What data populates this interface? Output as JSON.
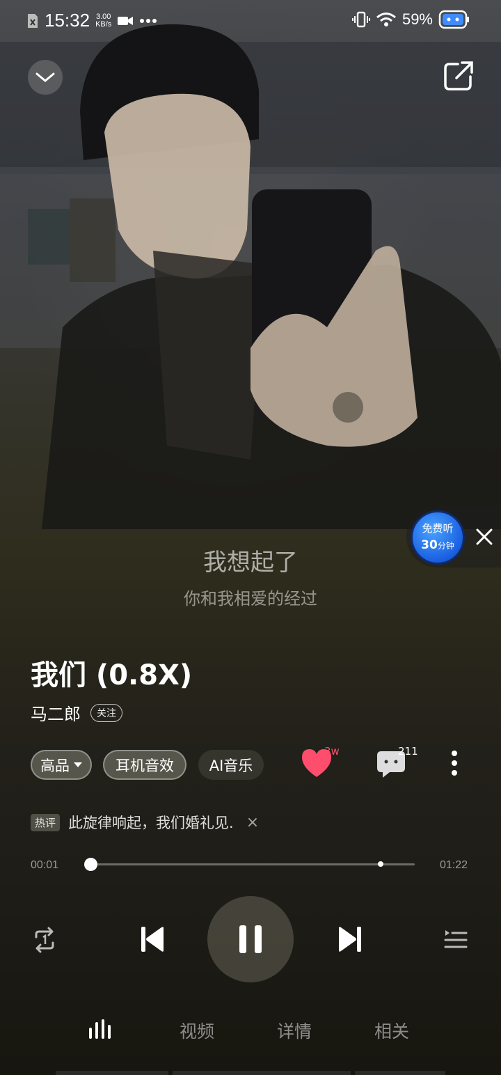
{
  "status_bar": {
    "time": "15:32",
    "speed_value": "3.00",
    "speed_unit": "KB/s",
    "battery": "59%"
  },
  "lyrics": {
    "current": "我想起了",
    "next": "你和我相爱的经过"
  },
  "promo": {
    "line1": "免费听",
    "line2_num": "30",
    "line2_unit": "分钟"
  },
  "song": {
    "title": "我们 (0.8X)",
    "artist": "马二郎",
    "follow_label": "关注"
  },
  "options": {
    "quality": "高品",
    "headphone_effect": "耳机音效",
    "ai_music": "AI音乐"
  },
  "actions": {
    "like_count": "3w",
    "comment_count": "211"
  },
  "hot_comment": {
    "tag": "热评",
    "text": "此旋律响起，我们婚礼见.",
    "close": "×"
  },
  "progress": {
    "current_time": "00:01",
    "total_time": "01:22",
    "played_fraction": 0.0,
    "buffered_fraction": 0.894
  },
  "bottom_tabs": {
    "video": "视频",
    "details": "详情",
    "related": "相关"
  },
  "colors": {
    "like_accent": "#ff4d6d",
    "promo_blue": "#2a7bf0"
  }
}
